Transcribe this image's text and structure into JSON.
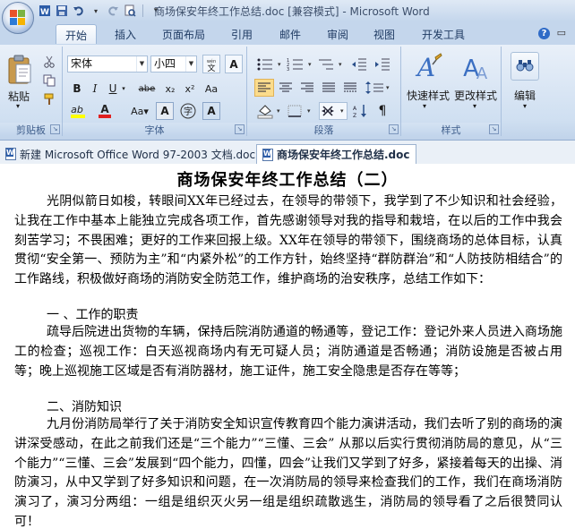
{
  "window": {
    "title": "商场保安年终工作总结.doc [兼容模式] - Microsoft Word"
  },
  "icons": {
    "office_button": "office-logo-icon",
    "qat": [
      "word-icon",
      "save-icon",
      "undo-icon",
      "redo-icon",
      "print-preview-icon",
      "customize-qat-icon"
    ]
  },
  "tabs": [
    "开始",
    "插入",
    "页面布局",
    "引用",
    "邮件",
    "审阅",
    "视图",
    "开发工具"
  ],
  "ribbon": {
    "clipboard": {
      "paste_label": "粘贴",
      "group_label": "剪贴板"
    },
    "font": {
      "font_name": "宋体",
      "font_size": "小四",
      "group_label": "字体"
    },
    "paragraph": {
      "group_label": "段落"
    },
    "styles": {
      "quick_styles_label": "快速样式",
      "change_styles_label": "更改样式",
      "group_label": "样式"
    },
    "editing": {
      "edit_label": "编辑"
    }
  },
  "doc_tabs": [
    {
      "label": "新建 Microsoft Office Word 97-2003 文档.doc",
      "active": false
    },
    {
      "label": "商场保安年终工作总结.doc",
      "active": true
    }
  ],
  "document": {
    "title": "商场保安年终工作总结（二）",
    "paragraphs": [
      "光阴似箭日如梭，转眼间XX年已经过去，在领导的带领下，我学到了不少知识和社会经验，让我在工作中基本上能独立完成各项工作，首先感谢领导对我的指导和栽培，在以后的工作中我会刻苦学习；不畏困难；更好的工作来回报上级。XX年在领导的带领下，围绕商场的总体目标，认真贯彻“安全第一、预防为主”和“内紧外松”的工作方针，始终坚持“群防群治”和“人防技防相结合”的工作路线，积极做好商场的消防安全防范工作，维护商场的治安秩序，总结工作如下：",
      "一 、工作的职责",
      "疏导后院进出货物的车辆，保持后院消防通道的畅通等，登记工作：登记外来人员进入商场施工的检查；巡视工作：白天巡视商场内有无可疑人员；消防通道是否畅通；消防设施是否被占用等；晚上巡视施工区域是否有消防器材，施工证件，施工安全隐患是否存在等等；",
      "二、消防知识",
      "九月份消防局举行了关于消防安全知识宣传教育四个能力演讲活动，我们去听了别的商场的演讲深受感动，在此之前我们还是“三个能力”“三懂、三会” 从那以后实行贯彻消防局的意见，从“三个能力”“三懂、三会”发展到“四个能力，四懂，四会”让我们又学到了好多，紧接着每天的出操、消防演习，从中又学到了好多知识和问题，在一次消防局的领导来检查我们的工作，我们在商场消防演习了，演习分两组：一组是组织灭火另一组是组织疏散逃生，消防局的领导看了之后很赞同认可！"
    ]
  }
}
